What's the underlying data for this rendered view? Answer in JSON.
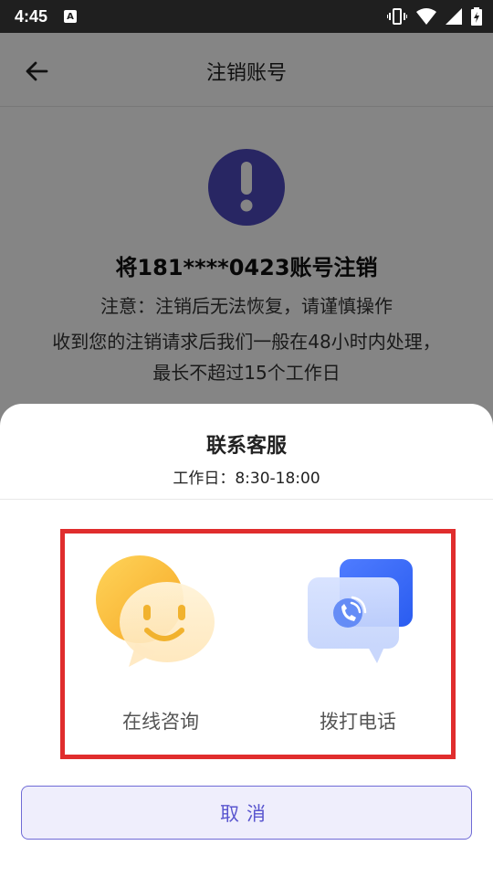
{
  "status_bar": {
    "time": "4:45",
    "app_icon_letter": "A",
    "icons": [
      "vibrate-icon",
      "wifi-icon",
      "signal-icon",
      "battery-icon"
    ]
  },
  "app_bar": {
    "back_icon": "arrow-left-icon",
    "title": "注销账号"
  },
  "content": {
    "warning_icon": "exclamation-icon",
    "heading": "将181****0423账号注销",
    "note": "注意：注销后无法恢复，请谨慎操作",
    "description_line1": "收到您的注销请求后我们一般在48小时内处理，",
    "description_line2": "最长不超过15个工作日"
  },
  "sheet": {
    "title": "联系客服",
    "hours": "工作日：8:30-18:00",
    "options": [
      {
        "label": "在线咨询",
        "icon": "chat-bubble-smile-icon"
      },
      {
        "label": "拨打电话",
        "icon": "phone-call-icon"
      }
    ],
    "cancel_label": "取消"
  },
  "colors": {
    "accent": "#4d49bf",
    "cancel_text": "#5a56cf",
    "highlight_border": "#e02d2d",
    "overlay": "rgba(0,0,0,0.48)"
  }
}
